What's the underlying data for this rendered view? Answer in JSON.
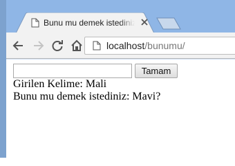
{
  "browser": {
    "tab_title": "Bunu mu demek istediniz?",
    "url_host": "localhost",
    "url_path": "/bunumu/"
  },
  "page": {
    "input_value": "",
    "submit_label": "Tamam",
    "entered_word_label": "Girilen Kelime:",
    "entered_word": "Mali",
    "suggestion_label": "Bunu mu demek istediniz:",
    "suggestion": "Mavi?"
  },
  "colors": {
    "frame_blue": "#8fb6e6",
    "tab_background": "#f2f2f2",
    "toolbar_background": "#f2f2f2"
  },
  "icons": [
    "page-icon",
    "close-icon",
    "new-tab-icon",
    "back-arrow-icon",
    "forward-arrow-icon",
    "reload-icon",
    "home-icon",
    "page-info-icon"
  ]
}
